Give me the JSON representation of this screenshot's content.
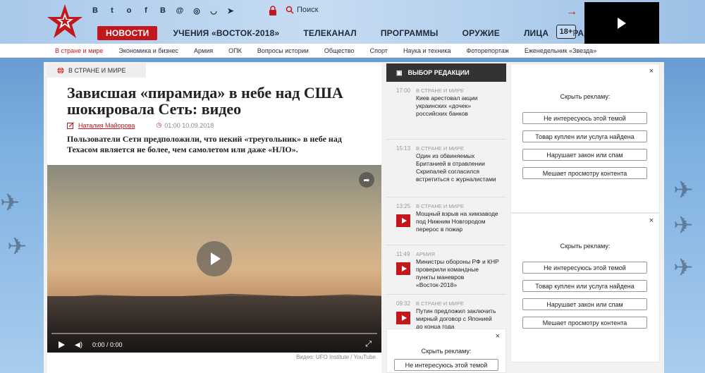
{
  "header": {
    "social_icons": [
      "vk-icon",
      "twitter-icon",
      "odnoklassniki-icon",
      "facebook-icon",
      "livejournal-icon",
      "mail-icon",
      "instagram-icon",
      "zen-icon",
      "telegram-icon"
    ],
    "search_label": "Поиск",
    "nav": [
      {
        "label": "НОВОСТИ",
        "active": true
      },
      {
        "label": "УЧЕНИЯ «ВОСТОК-2018»",
        "active": false
      },
      {
        "label": "ТЕЛЕКАНАЛ",
        "active": false
      },
      {
        "label": "ПРОГРАММЫ",
        "active": false
      },
      {
        "label": "ОРУЖИЕ",
        "active": false
      },
      {
        "label": "ЛИЦА",
        "active": false
      },
      {
        "label": "РАДИО",
        "active": false
      }
    ],
    "age_rating": "18+",
    "accent_color": "#c2171c"
  },
  "subnav": [
    {
      "label": "В стране и мире",
      "active": true
    },
    {
      "label": "Экономика и бизнес"
    },
    {
      "label": "Армия"
    },
    {
      "label": "ОПК"
    },
    {
      "label": "Вопросы истории"
    },
    {
      "label": "Общество"
    },
    {
      "label": "Спорт"
    },
    {
      "label": "Наука и техника"
    },
    {
      "label": "Фоторепортаж"
    },
    {
      "label": "Еженедельник «Звезда»"
    }
  ],
  "article": {
    "rubric": "В СТРАНЕ И МИРЕ",
    "title": "Зависшая «пирамида» в небе над США шокировала Сеть: видео",
    "author": "Наталия Майорова",
    "time": "01:00 10.09.2018",
    "lead": "Пользователи Сети предположили, что некий «треугольник» в небе над Техасом является не более, чем самолетом или даже «НЛО».",
    "video": {
      "time": "0:00 / 0:00",
      "progress": 0
    },
    "caption": "Видео: UFO Institute / YouTube"
  },
  "editors": {
    "title": "ВЫБОР РЕДАКЦИИ",
    "items": [
      {
        "time": "17:00",
        "rubric": "В СТРАНЕ И МИРЕ",
        "title": "Киев арестовал акции украинских «дочек» российских банков",
        "video": false
      },
      {
        "time": "15:13",
        "rubric": "В СТРАНЕ И МИРЕ",
        "title": "Один из обвиняемых Британией в отравлении Скрипалей согласился встретиться с журналистами",
        "video": false
      },
      {
        "time": "13:25",
        "rubric": "В СТРАНЕ И МИРЕ",
        "title": "Мощный взрыв на химзаводе под Нижним Новгородом перерос в пожар",
        "video": true
      },
      {
        "time": "11:49",
        "rubric": "АРМИЯ",
        "title": "Министры обороны РФ и КНР проверили командные пункты маневров «Восток-2018»",
        "video": true
      },
      {
        "time": "09:32",
        "rubric": "В СТРАНЕ И МИРЕ",
        "title": "Путин предложил заключить мирный договор с Японией до конца года",
        "video": true
      }
    ]
  },
  "ads": {
    "hide_title": "Скрыть рекламу:",
    "close": "×",
    "buttons": [
      "Не интересуюсь этой темой",
      "Товар куплен или услуга найдена",
      "Нарушает закон или спам",
      "Мешает просмотру контента"
    ]
  }
}
